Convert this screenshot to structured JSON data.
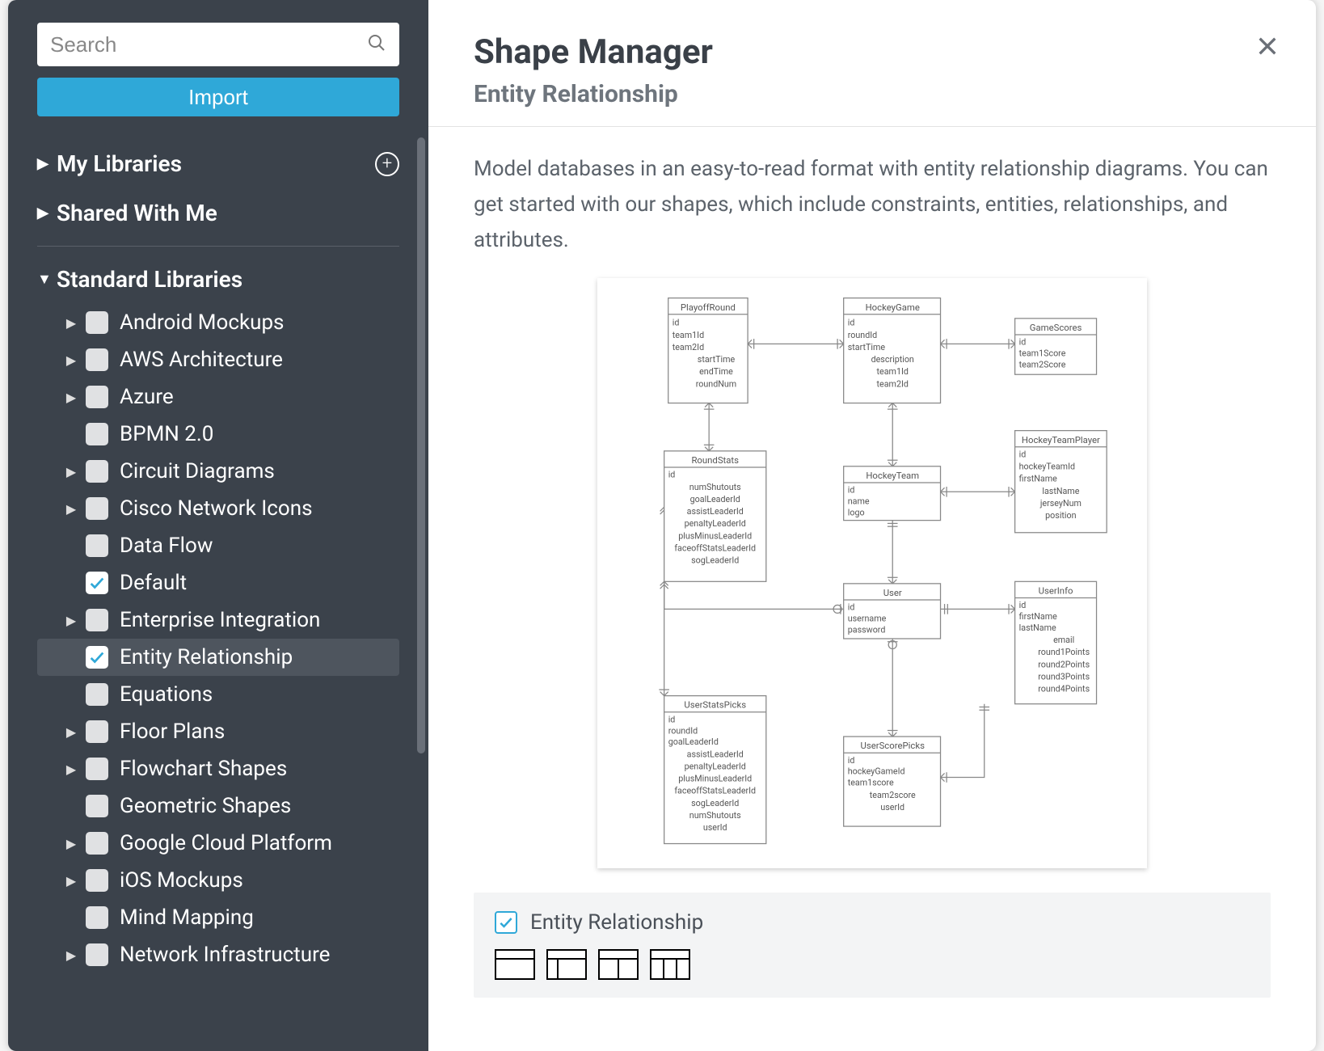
{
  "sidebar": {
    "search_placeholder": "Search",
    "import_label": "Import",
    "sections": {
      "my_libraries": "My Libraries",
      "shared": "Shared With Me",
      "standard": "Standard Libraries"
    },
    "libraries": [
      {
        "label": "Android Mockups",
        "expandable": true,
        "checked": false,
        "selected": false
      },
      {
        "label": "AWS Architecture",
        "expandable": true,
        "checked": false,
        "selected": false
      },
      {
        "label": "Azure",
        "expandable": true,
        "checked": false,
        "selected": false
      },
      {
        "label": "BPMN 2.0",
        "expandable": false,
        "checked": false,
        "selected": false
      },
      {
        "label": "Circuit Diagrams",
        "expandable": true,
        "checked": false,
        "selected": false
      },
      {
        "label": "Cisco Network Icons",
        "expandable": true,
        "checked": false,
        "selected": false
      },
      {
        "label": "Data Flow",
        "expandable": false,
        "checked": false,
        "selected": false
      },
      {
        "label": "Default",
        "expandable": false,
        "checked": true,
        "selected": false
      },
      {
        "label": "Enterprise Integration",
        "expandable": true,
        "checked": false,
        "selected": false
      },
      {
        "label": "Entity Relationship",
        "expandable": false,
        "checked": true,
        "selected": true
      },
      {
        "label": "Equations",
        "expandable": false,
        "checked": false,
        "selected": false
      },
      {
        "label": "Floor Plans",
        "expandable": true,
        "checked": false,
        "selected": false
      },
      {
        "label": "Flowchart Shapes",
        "expandable": true,
        "checked": false,
        "selected": false
      },
      {
        "label": "Geometric Shapes",
        "expandable": false,
        "checked": false,
        "selected": false
      },
      {
        "label": "Google Cloud Platform",
        "expandable": true,
        "checked": false,
        "selected": false
      },
      {
        "label": "iOS Mockups",
        "expandable": true,
        "checked": false,
        "selected": false
      },
      {
        "label": "Mind Mapping",
        "expandable": false,
        "checked": false,
        "selected": false
      },
      {
        "label": "Network Infrastructure",
        "expandable": true,
        "checked": false,
        "selected": false
      }
    ]
  },
  "main": {
    "title": "Shape Manager",
    "subtitle": "Entity Relationship",
    "description": "Model databases in an easy-to-read format with entity relationship diagrams. You can get started with our shapes, which include constraints, entities, relationships, and attributes.",
    "card_title": "Entity Relationship"
  },
  "er_diagram": {
    "entities": [
      {
        "name": "PlayoffRound",
        "fields": [
          "id",
          "team1Id",
          "team2Id",
          "startTime",
          "endTime",
          "roundNum"
        ]
      },
      {
        "name": "HockeyGame",
        "fields": [
          "id",
          "roundId",
          "startTime",
          "description",
          "team1Id",
          "team2Id"
        ]
      },
      {
        "name": "GameScores",
        "fields": [
          "id",
          "team1Score",
          "team2Score"
        ]
      },
      {
        "name": "RoundStats",
        "fields": [
          "id",
          "numShutouts",
          "goalLeaderId",
          "assistLeaderId",
          "penaltyLeaderId",
          "plusMinusLeaderId",
          "faceoffStatsLeaderId",
          "sogLeaderId"
        ]
      },
      {
        "name": "HockeyTeam",
        "fields": [
          "id",
          "name",
          "logo"
        ]
      },
      {
        "name": "HockeyTeamPlayer",
        "fields": [
          "id",
          "hockeyTeamId",
          "firstName",
          "lastName",
          "jerseyNum",
          "position"
        ]
      },
      {
        "name": "User",
        "fields": [
          "id",
          "username",
          "password"
        ]
      },
      {
        "name": "UserInfo",
        "fields": [
          "id",
          "firstName",
          "lastName",
          "email",
          "round1Points",
          "round2Points",
          "round3Points",
          "round4Points"
        ]
      },
      {
        "name": "UserStatsPicks",
        "fields": [
          "id",
          "roundId",
          "goalLeaderId",
          "assistLeaderId",
          "penaltyLeaderId",
          "plusMinusLeaderId",
          "faceoffStatsLeaderId",
          "sogLeaderId",
          "numShutouts",
          "userId"
        ]
      },
      {
        "name": "UserScorePicks",
        "fields": [
          "id",
          "hockeyGameId",
          "team1score",
          "team2score",
          "userId"
        ]
      }
    ]
  }
}
